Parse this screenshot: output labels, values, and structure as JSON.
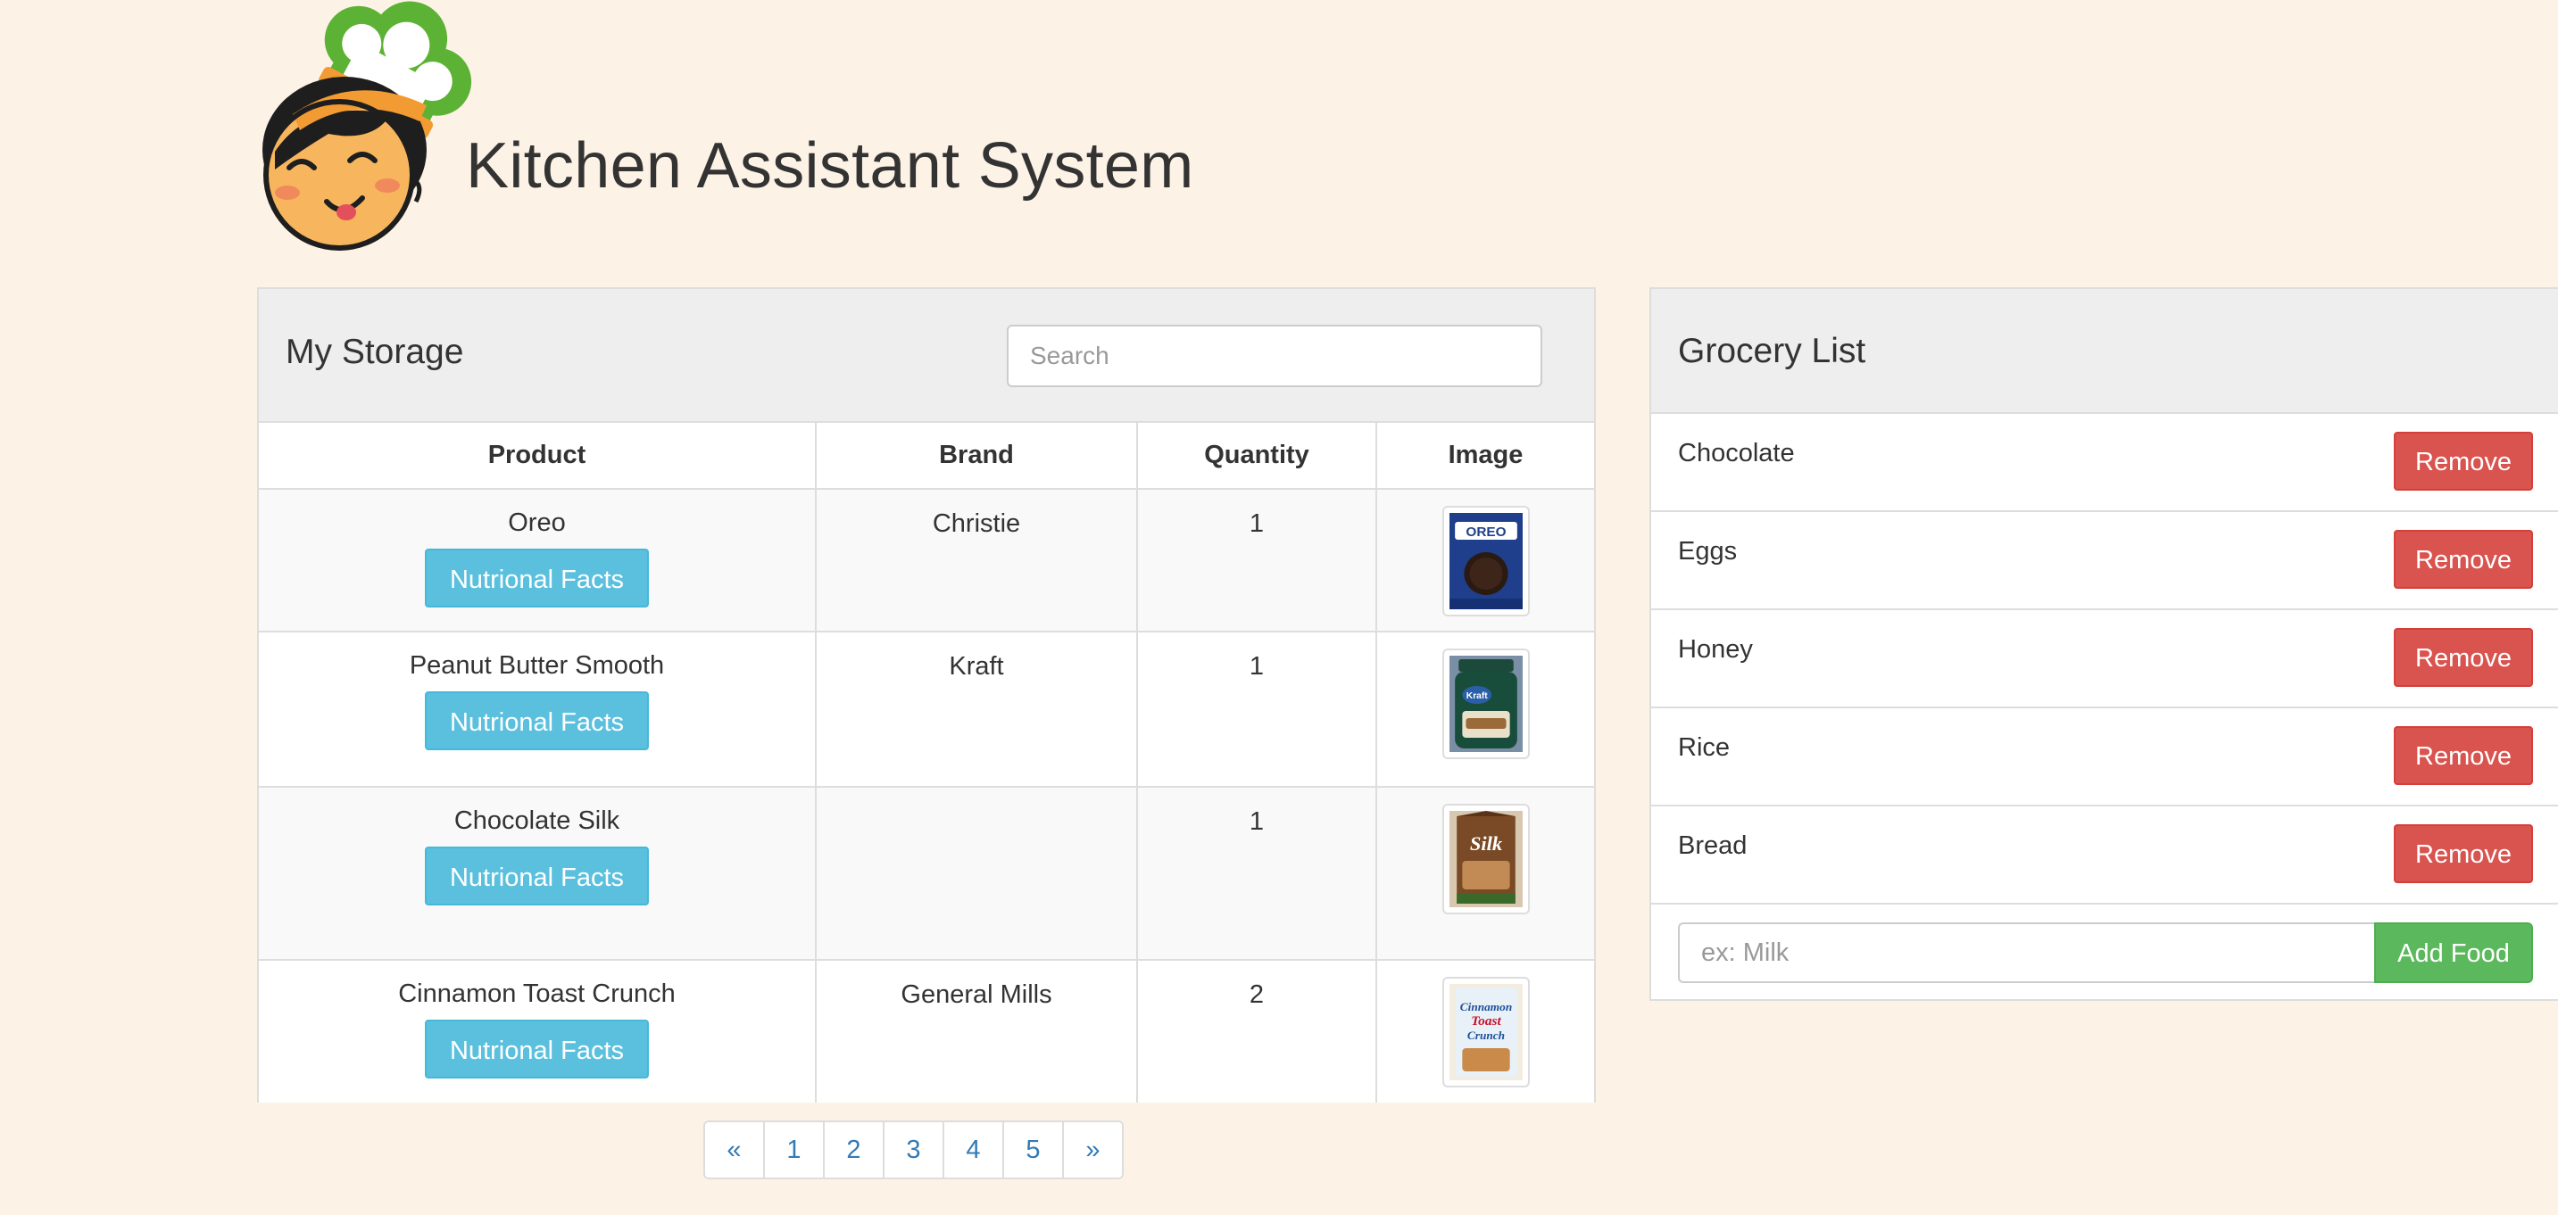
{
  "header": {
    "title": "Kitchen Assistant System",
    "logo_icon": "chef-mascot-icon"
  },
  "storage": {
    "title": "My Storage",
    "search_placeholder": "Search",
    "columns": [
      "Product",
      "Brand",
      "Quantity",
      "Image"
    ],
    "facts_label": "Nutrional Facts",
    "rows": [
      {
        "product": "Oreo",
        "brand": "Christie",
        "quantity": "1",
        "image_icon": "oreo-package-icon"
      },
      {
        "product": "Peanut Butter Smooth",
        "brand": "Kraft",
        "quantity": "1",
        "image_icon": "peanut-butter-jar-icon"
      },
      {
        "product": "Chocolate Silk",
        "brand": "",
        "quantity": "1",
        "image_icon": "silk-carton-icon"
      },
      {
        "product": "Cinnamon Toast Crunch",
        "brand": "General Mills",
        "quantity": "2",
        "image_icon": "cereal-box-icon"
      }
    ]
  },
  "pagination": {
    "prev": "«",
    "pages": [
      "1",
      "2",
      "3",
      "4",
      "5"
    ],
    "next": "»"
  },
  "grocery": {
    "title": "Grocery List",
    "remove_label": "Remove",
    "items": [
      "Chocolate",
      "Eggs",
      "Honey",
      "Rice",
      "Bread"
    ],
    "add_placeholder": "ex: Milk",
    "add_label": "Add Food"
  },
  "colors": {
    "background": "#fdf2e6",
    "info": "#5bc0de",
    "danger": "#d9534f",
    "success": "#5cb85c",
    "link": "#337ab7"
  }
}
